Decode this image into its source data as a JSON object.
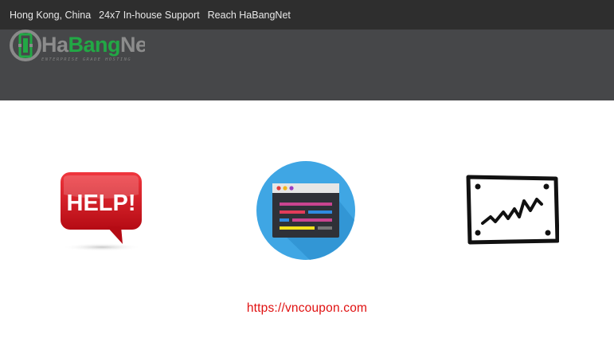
{
  "topbar": {
    "links": [
      {
        "label": "Hong Kong, China"
      },
      {
        "label": "24x7 In-house Support"
      },
      {
        "label": "Reach HaBangNet"
      }
    ]
  },
  "logo": {
    "name_part1": "Ha",
    "name_part2": "Bang",
    "name_part3": "Net",
    "tagline": "ENTERPRISE GRADE HOSTING"
  },
  "icons": [
    {
      "name": "help-speech-bubble-icon",
      "text": "HELP!"
    },
    {
      "name": "code-editor-icon"
    },
    {
      "name": "line-chart-icon"
    }
  ],
  "watermark": {
    "url": "https://vncoupon.com"
  },
  "colors": {
    "topbar_bg": "#2e2e2e",
    "header_bg": "#464749",
    "brand_green": "#22a845",
    "help_red": "#d0131d",
    "code_blue": "#3fa6e4",
    "url_red": "#e01010"
  }
}
